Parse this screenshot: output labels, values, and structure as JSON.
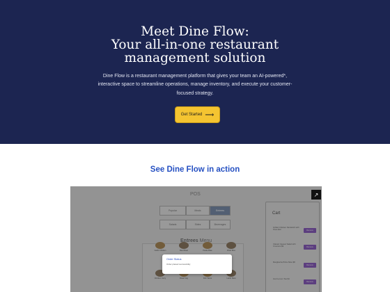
{
  "hero": {
    "title_line1": "Meet Dine Flow:",
    "title_line2": "Your all-in-one restaurant",
    "title_line3": "management solution",
    "description": "Dine Flow is a restaurant management platform that gives your team an AI-powered*, interactive space to streamline operations, manage inventory, and execute your customer-focused strategy.",
    "cta_label": "Get Started",
    "cta_arrow": "⟶"
  },
  "demo_section": {
    "title": "See Dine Flow in action",
    "expand_icon": "↗"
  },
  "pos": {
    "title": "POS",
    "categories": [
      "Popular",
      "Meals",
      "Entrees",
      "Salads",
      "Sides",
      "Beverages"
    ],
    "active_category": "Entrees",
    "menu_title_bold": "Entrees",
    "menu_title_rest": "Menu",
    "menu_items": [
      "Garlic Chicken",
      "Beef Bowl",
      "Pasta Plate",
      "Fried Rice",
      "Chicken Curry",
      "Roast Veg",
      "Fish Tacos",
      "Lamb Stew"
    ]
  },
  "cart": {
    "title": "Cart",
    "items": [
      {
        "name": "Grilled Chicken Sandwich with Fries $12",
        "action": "Remove"
      },
      {
        "name": "Classic Caesar Salad with Croutons $9",
        "action": "Remove"
      },
      {
        "name": "Margherita Pizza Slice $8",
        "action": "Remove"
      },
      {
        "name": "Iced Lemon Tea $4",
        "action": "Remove"
      }
    ]
  },
  "modal": {
    "title": "Order Status",
    "message": "Order placed successfully"
  },
  "colors": {
    "hero_bg": "#1c2551",
    "cta_bg": "#f4c431",
    "section_title": "#2550c2"
  }
}
